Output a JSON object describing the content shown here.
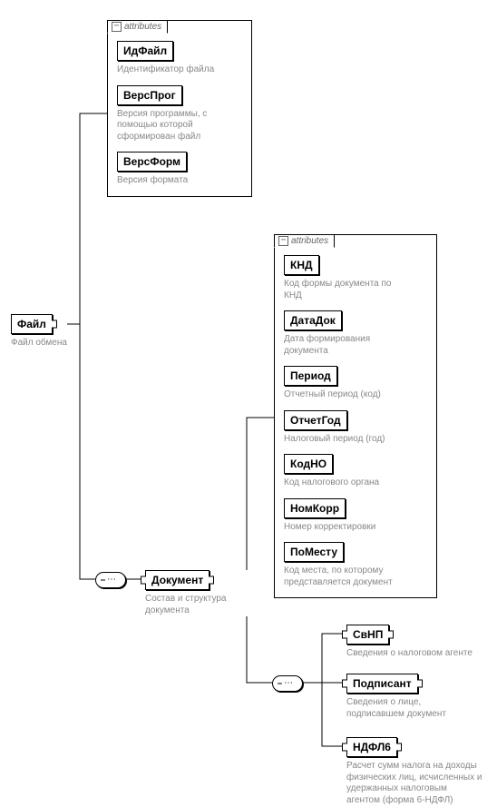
{
  "attrLabel": "attributes",
  "root": {
    "name": "Файл",
    "desc": "Файл обмена",
    "attributes": [
      {
        "name": "ИдФайл",
        "desc": "Идентификатор файла"
      },
      {
        "name": "ВерсПрог",
        "desc": "Версия программы, с помощью которой сформирован файл"
      },
      {
        "name": "ВерсФорм",
        "desc": "Версия формата"
      }
    ]
  },
  "document": {
    "name": "Документ",
    "desc": "Состав и структура документа",
    "attributes": [
      {
        "name": "КНД",
        "desc": "Код формы документа по КНД"
      },
      {
        "name": "ДатаДок",
        "desc": "Дата формирования документа"
      },
      {
        "name": "Период",
        "desc": "Отчетный период (код)"
      },
      {
        "name": "ОтчетГод",
        "desc": "Налоговый период (год)"
      },
      {
        "name": "КодНО",
        "desc": "Код налогового органа"
      },
      {
        "name": "НомКорр",
        "desc": "Номер корректировки"
      },
      {
        "name": "ПоМесту",
        "desc": "Код места, по которому представляется документ"
      }
    ],
    "children": [
      {
        "name": "СвНП",
        "desc": "Сведения о налоговом агенте"
      },
      {
        "name": "Подписант",
        "desc": "Сведения о лице, подписавшем документ"
      },
      {
        "name": "НДФЛ6",
        "desc": "Расчет сумм налога на доходы физических лиц, исчисленных и удержанных налоговым агентом (форма 6-НДФЛ)"
      }
    ]
  }
}
